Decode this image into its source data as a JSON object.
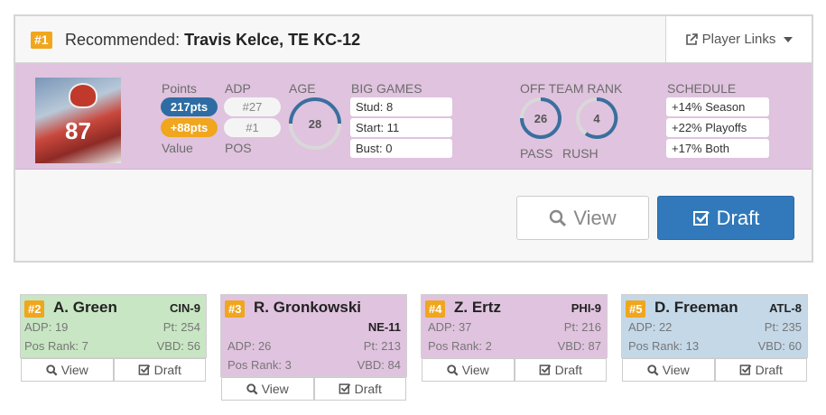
{
  "recommended": {
    "rank": "#1",
    "prefix": "Recommended:",
    "player": "Travis Kelce, TE KC-12",
    "links_label": "Player Links",
    "jersey_number": "87",
    "labels": {
      "points": "Points",
      "value": "Value",
      "adp": "ADP",
      "pos": "POS",
      "age": "AGE",
      "big_games": "BIG GAMES",
      "off_team_rank": "OFF TEAM RANK",
      "pass": "PASS",
      "rush": "RUSH",
      "schedule": "SCHEDULE"
    },
    "points": "217pts",
    "value": "+88pts",
    "adp": "#27",
    "pos": "#1",
    "age": "28",
    "big_games": [
      "Stud: 8",
      "Start: 11",
      "Bust: 0"
    ],
    "pass_rank": "26",
    "rush_rank": "4",
    "schedule": [
      "+14% Season",
      "+22% Playoffs",
      "+17% Both"
    ],
    "view_label": "View",
    "draft_label": "Draft"
  },
  "others": [
    {
      "rank": "#2",
      "name": "A. Green",
      "team": "CIN-9",
      "adp": "ADP: 19",
      "pt": "Pt: 254",
      "pos_rank": "Pos Rank: 7",
      "vbd": "VBD: 56",
      "view": "View",
      "draft": "Draft"
    },
    {
      "rank": "#3",
      "name": "R. Gronkowski",
      "team": "NE-11",
      "adp": "ADP: 26",
      "pt": "Pt: 213",
      "pos_rank": "Pos Rank: 3",
      "vbd": "VBD: 84",
      "view": "View",
      "draft": "Draft"
    },
    {
      "rank": "#4",
      "name": "Z. Ertz",
      "team": "PHI-9",
      "adp": "ADP: 37",
      "pt": "Pt: 216",
      "pos_rank": "Pos Rank: 2",
      "vbd": "VBD: 87",
      "view": "View",
      "draft": "Draft"
    },
    {
      "rank": "#5",
      "name": "D. Freeman",
      "team": "ATL-8",
      "adp": "ADP: 22",
      "pt": "Pt: 235",
      "pos_rank": "Pos Rank: 13",
      "vbd": "VBD: 60",
      "view": "View",
      "draft": "Draft"
    }
  ],
  "colors": {
    "accent_orange": "#f0a61d",
    "primary_blue": "#3179ba",
    "band_purple": "#e0c3df",
    "card_green": "#c8e6c3",
    "card_blue": "#c4d8e8"
  }
}
